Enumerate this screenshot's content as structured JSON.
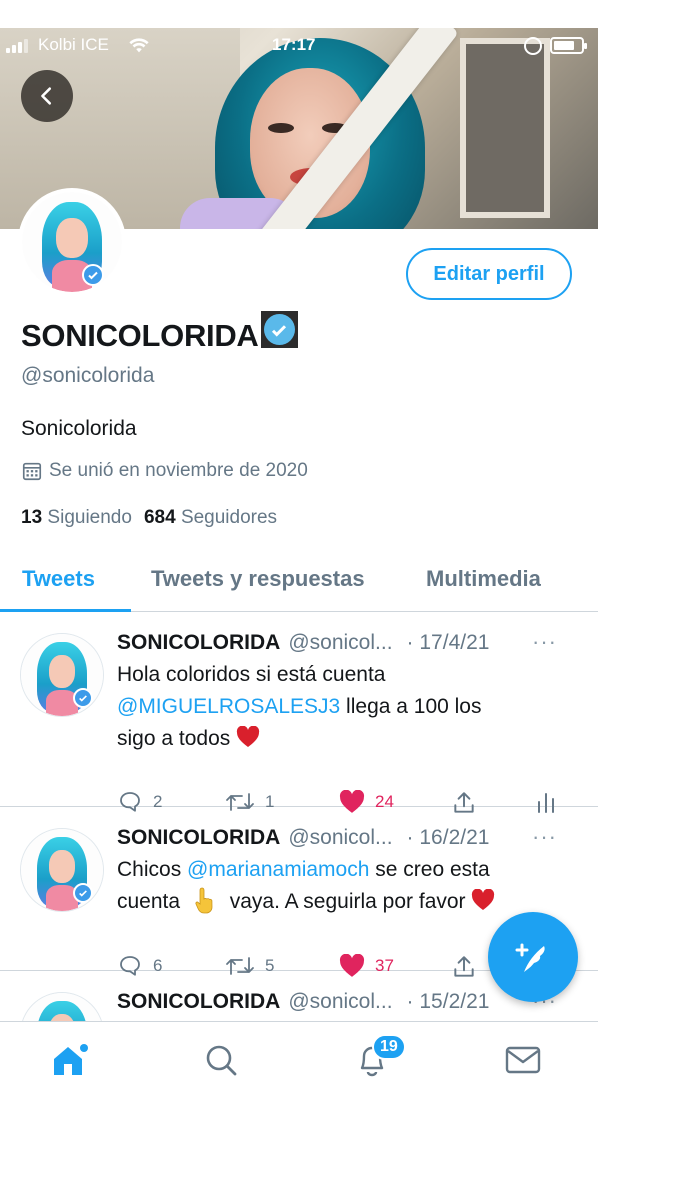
{
  "status_bar": {
    "carrier": "Kolbi ICE",
    "time": "17:17"
  },
  "profile": {
    "display_name": "SONICOLORIDA",
    "handle": "@sonicolorida",
    "bio": "Sonicolorida",
    "joined": "Se unió en noviembre de 2020",
    "following_count": "13",
    "following_label": "Siguiendo",
    "followers_count": "684",
    "followers_label": "Seguidores",
    "edit_button": "Editar perfil"
  },
  "tabs": [
    "Tweets",
    "Tweets y respuestas",
    "Multimedia"
  ],
  "tweets": [
    {
      "name": "SONICOLORIDA",
      "handle": "@sonicol...",
      "date": "· 17/4/21",
      "text_1": "Hola coloridos si está cuenta",
      "mention": "@MIGUELROSALESJ3",
      "text_2": " llega a 100 los",
      "text_3": "sigo a todos",
      "replies": "2",
      "retweets": "1",
      "likes": "24"
    },
    {
      "name": "SONICOLORIDA",
      "handle": "@sonicol...",
      "date": "· 16/2/21",
      "text_1": "Chicos ",
      "mention": "@marianamiamoch",
      "text_2": " se creo esta",
      "text_3": "cuenta",
      "text_4": "vaya. A seguirla por favor",
      "replies": "6",
      "retweets": "5",
      "likes": "37"
    },
    {
      "name": "SONICOLORIDA",
      "handle": "@sonicol...",
      "date": "· 15/2/21"
    }
  ],
  "more_icon": "···",
  "bottom_nav": {
    "notifications_count": "19"
  },
  "colors": {
    "accent": "#1da1f2",
    "like": "#e0245e",
    "muted": "#657786"
  }
}
